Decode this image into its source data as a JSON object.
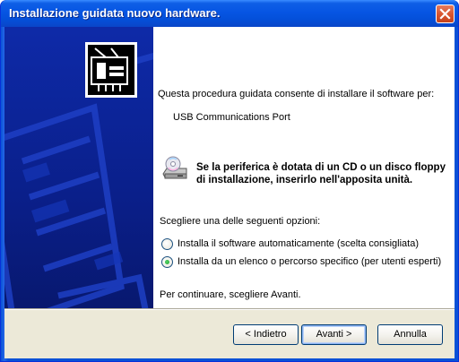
{
  "window": {
    "title": "Installazione guidata nuovo hardware."
  },
  "content": {
    "intro": "Questa procedura guidata consente di installare il software per:",
    "device_name": "USB Communications Port",
    "cd_notice": "Se la periferica è dotata di un CD o un disco floppy di installazione, inserirlo nell'apposita unità.",
    "options_prompt": "Scegliere una delle seguenti opzioni:",
    "options": [
      {
        "label": "Installa il software automaticamente (scelta consigliata)",
        "selected": false
      },
      {
        "label": "Installa da un elenco o percorso specifico (per utenti esperti)",
        "selected": true
      }
    ],
    "continue_hint": "Per continuare, scegliere Avanti."
  },
  "buttons": {
    "back": "< Indietro",
    "next": "Avanti >",
    "cancel": "Annulla"
  },
  "colors": {
    "title_bar": "#0655e3",
    "sidebar": "#0a1f8a",
    "dialog_face": "#ece9d8",
    "radio_selected": "#21a130"
  },
  "icons": {
    "sidebar": "hardware-card-icon",
    "cd": "cd-drive-icon",
    "close": "close-icon"
  }
}
